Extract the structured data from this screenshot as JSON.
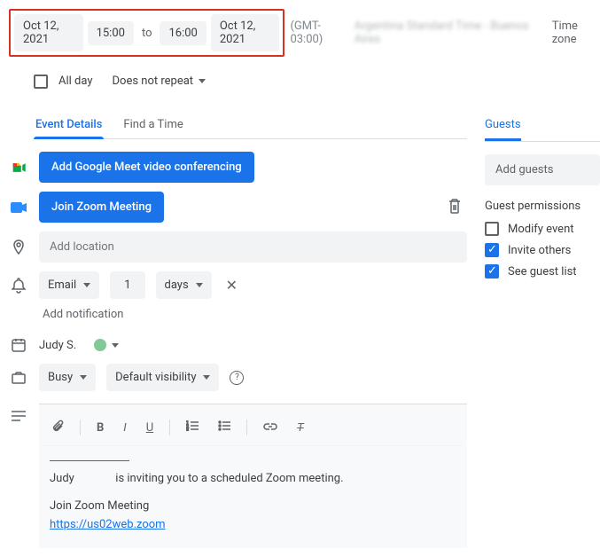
{
  "datetime": {
    "start_date": "Oct 12, 2021",
    "start_time": "15:00",
    "to": "to",
    "end_time": "16:00",
    "end_date": "Oct 12, 2021",
    "gmt": "(GMT-03:00)",
    "tz_blur": "Argentina Standard Time - Buenos Aires",
    "tz_link": "Time zone"
  },
  "allday": {
    "label": "All day",
    "repeat": "Does not repeat"
  },
  "tabs": {
    "details": "Event Details",
    "findtime": "Find a Time"
  },
  "meet": {
    "label": "Add Google Meet video conferencing"
  },
  "zoom": {
    "label": "Join Zoom Meeting"
  },
  "location": {
    "placeholder": "Add location"
  },
  "notif": {
    "email": "Email",
    "num": "1",
    "unit": "days",
    "add": "Add notification"
  },
  "owner": {
    "name": "Judy S."
  },
  "availability": {
    "busy": "Busy",
    "visibility": "Default visibility"
  },
  "desc": {
    "line1a": "Judy",
    "line1b": "is inviting you to a scheduled Zoom meeting.",
    "line2": "Join Zoom Meeting",
    "link": "https://us02web.zoom"
  },
  "guests": {
    "title": "Guests",
    "add": "Add guests",
    "perm_title": "Guest permissions",
    "modify": "Modify event",
    "invite": "Invite others",
    "seelist": "See guest list"
  }
}
